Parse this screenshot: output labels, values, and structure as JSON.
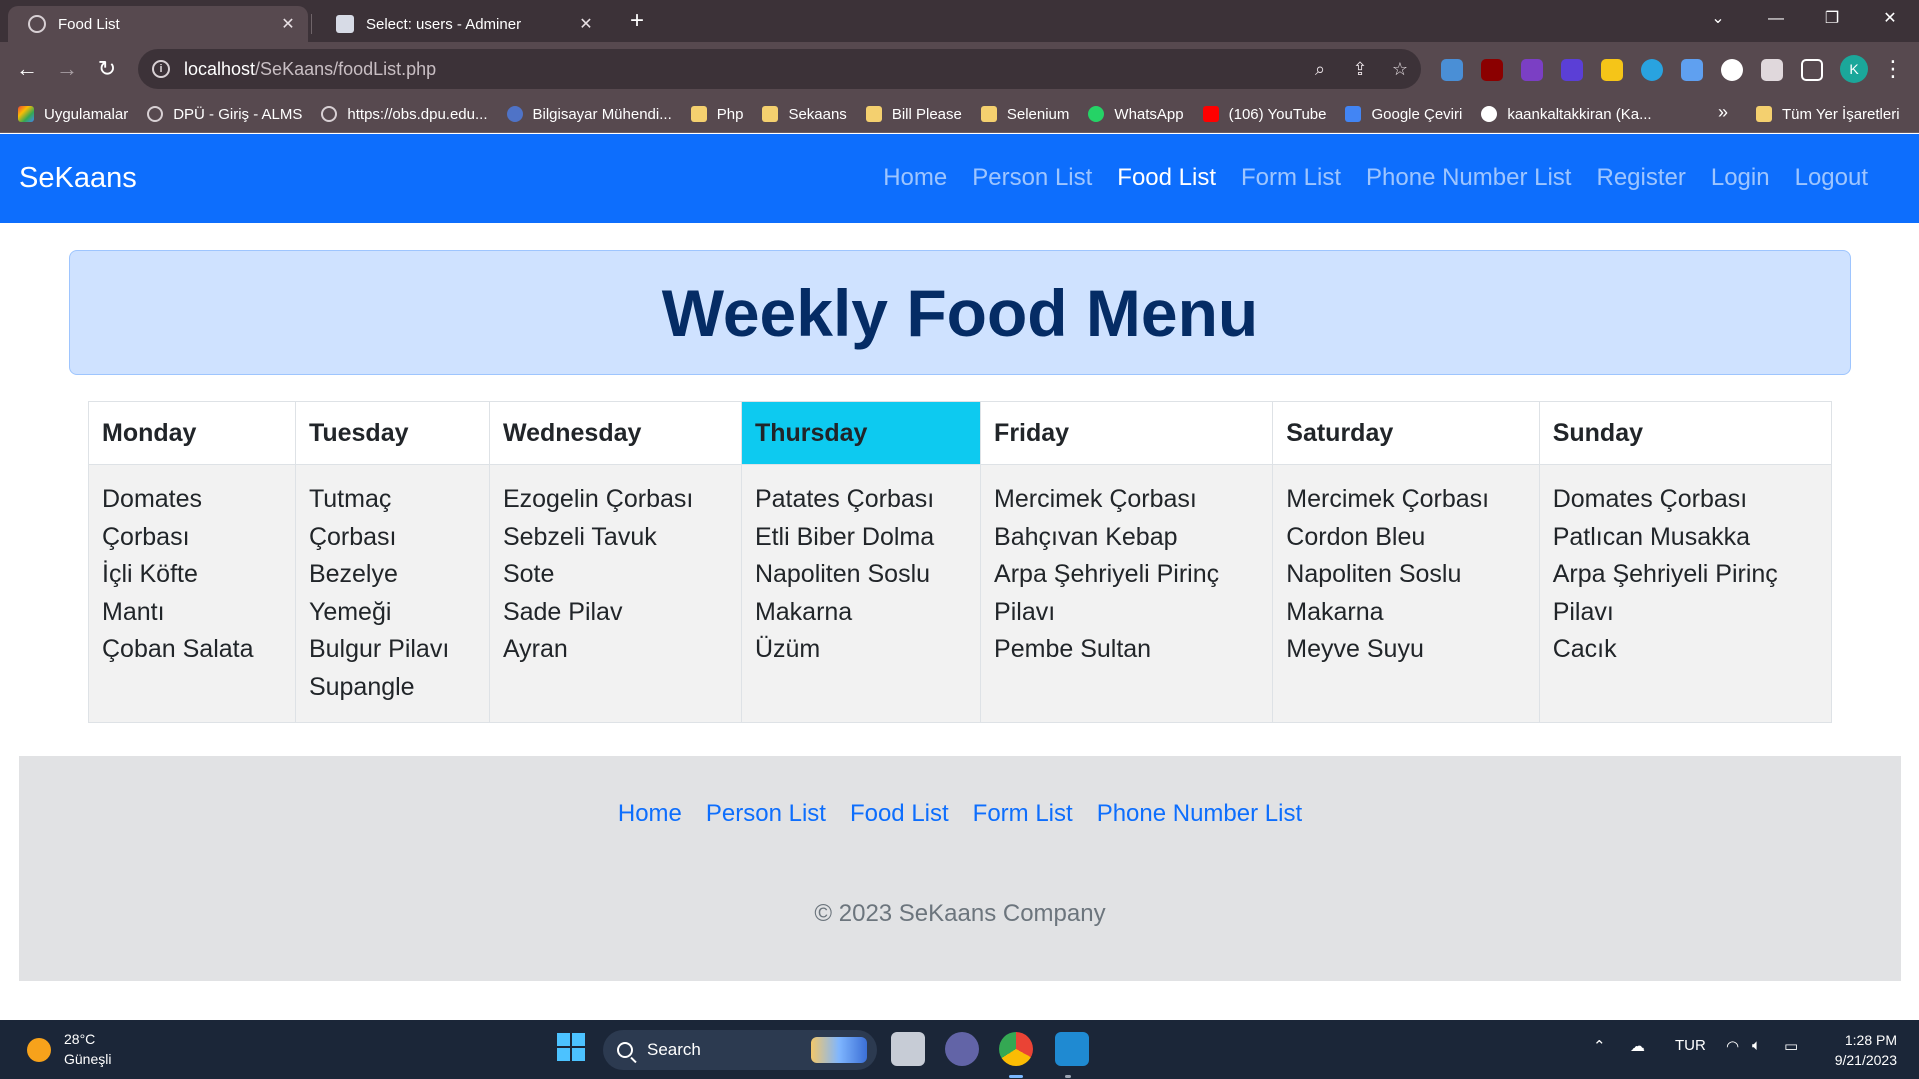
{
  "browser": {
    "tabs": [
      {
        "title": "Food List",
        "active": true
      },
      {
        "title": "Select: users - Adminer",
        "active": false
      }
    ],
    "address": {
      "host": "localhost",
      "path": "/SeKaans/foodList.php"
    },
    "bookmarks": [
      {
        "label": "Uygulamalar",
        "icon": "apps-grid-icon",
        "color": "#e94235"
      },
      {
        "label": "DPÜ - Giriş - ALMS",
        "icon": "globe-icon",
        "color": "#d8d0d4"
      },
      {
        "label": "https://obs.dpu.edu...",
        "icon": "globe-icon",
        "color": "#d8d0d4"
      },
      {
        "label": "Bilgisayar Mühendi...",
        "icon": "site-icon",
        "color": "#4f73c7"
      },
      {
        "label": "Php",
        "icon": "folder-icon",
        "color": "#f4d06f"
      },
      {
        "label": "Sekaans",
        "icon": "folder-icon",
        "color": "#f4d06f"
      },
      {
        "label": "Bill Please",
        "icon": "folder-icon",
        "color": "#f4d06f"
      },
      {
        "label": "Selenium",
        "icon": "folder-icon",
        "color": "#f4d06f"
      },
      {
        "label": "WhatsApp",
        "icon": "whatsapp-icon",
        "color": "#25d366"
      },
      {
        "label": "(106) YouTube",
        "icon": "youtube-icon",
        "color": "#ff0000"
      },
      {
        "label": "Google Çeviri",
        "icon": "translate-icon",
        "color": "#4285f4"
      },
      {
        "label": "kaankaltakkiran (Ka...",
        "icon": "github-icon",
        "color": "#ffffff"
      }
    ],
    "bookmarks_more": "»",
    "all_bookmarks": "Tüm Yer İşaretleri",
    "profile_initial": "K"
  },
  "navbar": {
    "brand": "SeKaans",
    "links": [
      "Home",
      "Person List",
      "Food List",
      "Form List",
      "Phone Number List",
      "Register",
      "Login",
      "Logout"
    ],
    "active": "Food List"
  },
  "hero": {
    "title": "Weekly Food Menu"
  },
  "menu": {
    "highlight_day": "Thursday",
    "days": [
      {
        "day": "Monday",
        "items": [
          "Domates",
          "Çorbası",
          "İçli Köfte",
          "Mantı",
          "Çoban Salata"
        ]
      },
      {
        "day": "Tuesday",
        "items": [
          "Tutmaç",
          "Çorbası",
          "Bezelye",
          "Yemeği",
          "Bulgur Pilavı",
          "Supangle"
        ]
      },
      {
        "day": "Wednesday",
        "items": [
          "Ezogelin Çorbası",
          "Sebzeli Tavuk",
          "Sote",
          "Sade Pilav",
          "Ayran"
        ]
      },
      {
        "day": "Thursday",
        "items": [
          "Patates Çorbası",
          "Etli Biber Dolma",
          "Napoliten Soslu",
          "Makarna",
          "Üzüm"
        ]
      },
      {
        "day": "Friday",
        "items": [
          "Mercimek Çorbası",
          "Bahçıvan Kebap",
          "Arpa Şehriyeli Pirinç",
          "Pilavı",
          "Pembe Sultan"
        ]
      },
      {
        "day": "Saturday",
        "items": [
          "Mercimek Çorbası",
          "Cordon Bleu",
          "Napoliten Soslu",
          "Makarna",
          "Meyve Suyu"
        ]
      },
      {
        "day": "Sunday",
        "items": [
          "Domates Çorbası",
          "Patlıcan Musakka",
          "Arpa Şehriyeli Pirinç",
          "Pilavı",
          "Cacık"
        ]
      }
    ]
  },
  "footer": {
    "links": [
      "Home",
      "Person List",
      "Food List",
      "Form List",
      "Phone Number List"
    ],
    "copyright": "© 2023 SeKaans Company"
  },
  "taskbar": {
    "weather": {
      "temp": "28°C",
      "desc": "Güneşli"
    },
    "search_label": "Search",
    "language": "TUR",
    "time": "1:28 PM",
    "date": "9/21/2023"
  },
  "colors": {
    "navbar": "#0d6efd",
    "alert_bg": "#cfe2ff",
    "alert_text": "#052c65",
    "highlight": "#0dcaf0",
    "footer_bg": "#e1e2e4"
  }
}
